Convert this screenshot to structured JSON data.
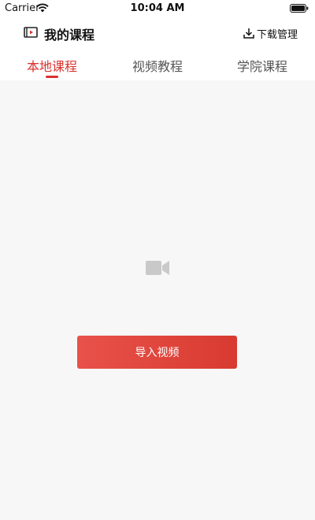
{
  "status_bar": {
    "carrier": "Carrier",
    "time": "10:04 AM"
  },
  "header": {
    "title": "我的课程",
    "title_icon": "video-player-icon",
    "download_label": "下载管理",
    "download_icon": "download-icon"
  },
  "tabs": [
    {
      "label": "本地课程",
      "active": true
    },
    {
      "label": "视频教程",
      "active": false
    },
    {
      "label": "学院课程",
      "active": false
    }
  ],
  "main": {
    "placeholder_icon": "video-camera-icon",
    "import_button": "导入视频"
  },
  "colors": {
    "accent": "#d9322c",
    "background": "#f7f7f7",
    "button_gradient_start": "#e8524a",
    "button_gradient_end": "#d83a30"
  }
}
